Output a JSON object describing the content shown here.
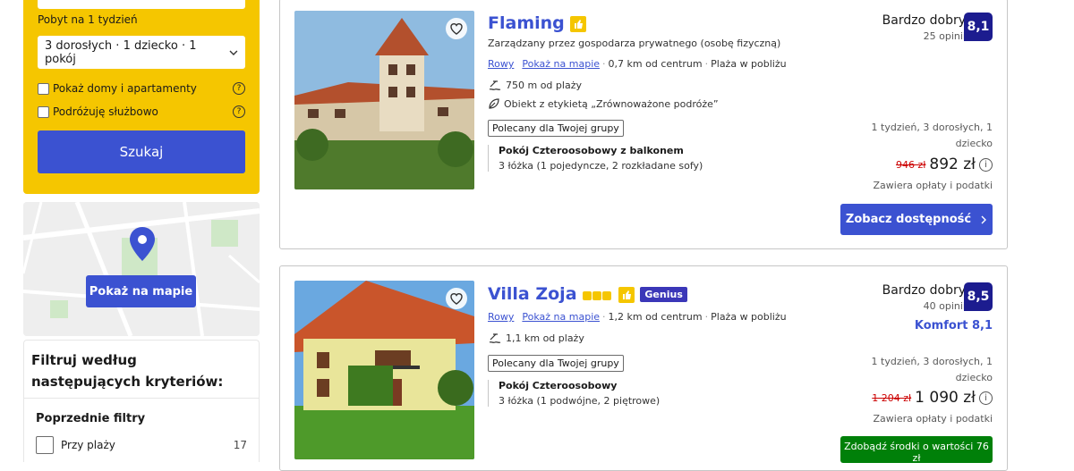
{
  "search": {
    "stay_label": "Pobyt na 1 tydzień",
    "guests_value": "3 dorosłych · 1 dziecko · 1 pokój",
    "check_homes": "Pokaż domy i apartamenty",
    "check_business": "Podróżuję służbowo",
    "search_button": "Szukaj"
  },
  "map": {
    "button": "Pokaż na mapie"
  },
  "filters": {
    "title": "Filtruj według następujących kryteriów:",
    "previous_title": "Poprzednie filtry",
    "items": [
      {
        "label": "Przy plaży",
        "count": "17"
      }
    ]
  },
  "hotels": [
    {
      "name": "Flaming",
      "host": "Zarządzany przez gospodarza prywatnego (osobę fizyczną)",
      "location": "Rowy",
      "show_map": "Pokaż na mapie",
      "distance": "0,7 km od centrum",
      "beach": "Plaża w pobliżu",
      "beach_distance": "750 m od plaży",
      "sustainable": "Obiekt z etykietą „Zrównoważone podróże”",
      "tag": "Polecany dla Twojej grupy",
      "room_name": "Pokój Czteroosobowy z balkonem",
      "room_beds": "3 łóżka (1 pojedyncze, 2 rozkładane sofy)",
      "rating_word": "Bardzo dobry",
      "reviews": "25 opinii",
      "score": "8,1",
      "stay_info": "1 tydzień, 3 dorosłych, 1 dziecko",
      "old_price": "946 zł",
      "price": "892 zł",
      "taxes": "Zawiera opłaty i podatki",
      "cta": "Zobacz dostępność"
    },
    {
      "name": "Villa Zoja",
      "genius": "Genius",
      "location": "Rowy",
      "show_map": "Pokaż na mapie",
      "distance": "1,2 km od centrum",
      "beach": "Plaża w pobliżu",
      "beach_distance": "1,1 km od plaży",
      "tag": "Polecany dla Twojej grupy",
      "room_name": "Pokój Czteroosobowy",
      "room_beds": "3 łóżka (1 podwójne, 2 piętrowe)",
      "rating_word": "Bardzo dobry",
      "reviews": "40 opinii",
      "score": "8,5",
      "comfort": "Komfort 8,1",
      "stay_info": "1 tydzień, 3 dorosłych, 1 dziecko",
      "old_price": "1 204 zł",
      "price": "1 090 zł",
      "taxes": "Zawiera opłaty i podatki",
      "cta": "Zdobądź środki o wartości 76 zł"
    }
  ],
  "colors": {
    "accent": "#3b52d1",
    "yellow": "#f5c600",
    "score": "#1c1c8f",
    "green": "#008009"
  }
}
